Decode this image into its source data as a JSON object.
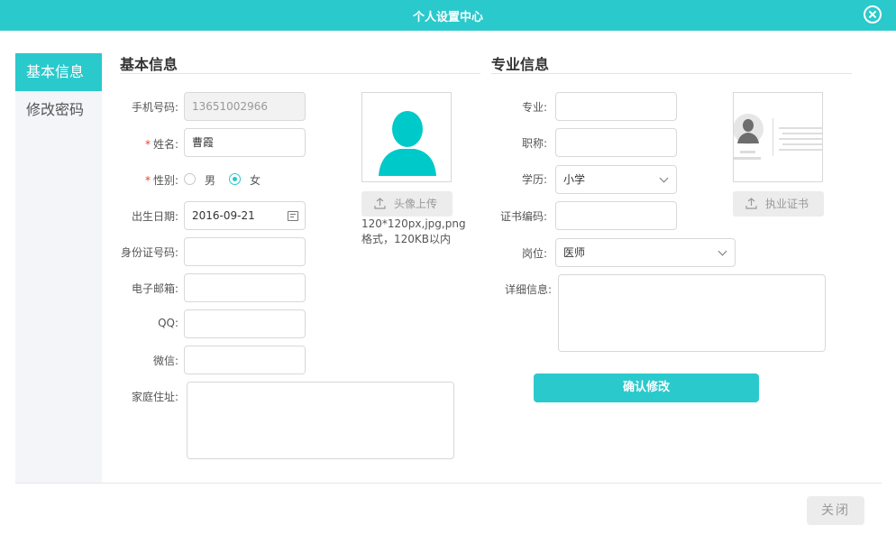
{
  "dialog": {
    "title": "个人设置中心",
    "close_icon": "close-circle-icon"
  },
  "sidebar": {
    "items": [
      {
        "label": "基本信息",
        "active": true
      },
      {
        "label": "修改密码",
        "active": false
      }
    ]
  },
  "basic": {
    "section_title": "基本信息",
    "phone": {
      "label": "手机号码:",
      "value": "13651002966"
    },
    "name": {
      "required_mark": "*",
      "label": "姓名:",
      "value": "曹霞"
    },
    "gender": {
      "required_mark": "*",
      "label": "性别:",
      "options": [
        "男",
        "女"
      ],
      "selected": "女"
    },
    "birth": {
      "label": "出生日期:",
      "value": "2016-09-21"
    },
    "id_card": {
      "label": "身份证号码:",
      "value": ""
    },
    "email": {
      "label": "电子邮箱:",
      "value": ""
    },
    "qq": {
      "label": "QQ:",
      "value": ""
    },
    "wechat": {
      "label": "微信:",
      "value": ""
    },
    "address": {
      "label": "家庭住址:",
      "value": ""
    },
    "avatar": {
      "upload_label": "头像上传",
      "hint_line1": "120*120px,jpg,png",
      "hint_line2": "格式，120KB以内"
    }
  },
  "professional": {
    "section_title": "专业信息",
    "major": {
      "label": "专业:",
      "value": ""
    },
    "title": {
      "label": "职称:",
      "value": ""
    },
    "education": {
      "label": "学历:",
      "value": "小学"
    },
    "cert_no": {
      "label": "证书编码:",
      "value": ""
    },
    "post": {
      "label": "岗位:",
      "value": "医师"
    },
    "detail": {
      "label": "详细信息:",
      "value": ""
    },
    "license": {
      "upload_label": "执业证书"
    },
    "confirm_label": "确认修改"
  },
  "footer": {
    "close_label": "关闭"
  },
  "colors": {
    "accent": "#2ac9cc",
    "required": "#e8402a",
    "sidebar_bg": "#f4f5f9"
  }
}
